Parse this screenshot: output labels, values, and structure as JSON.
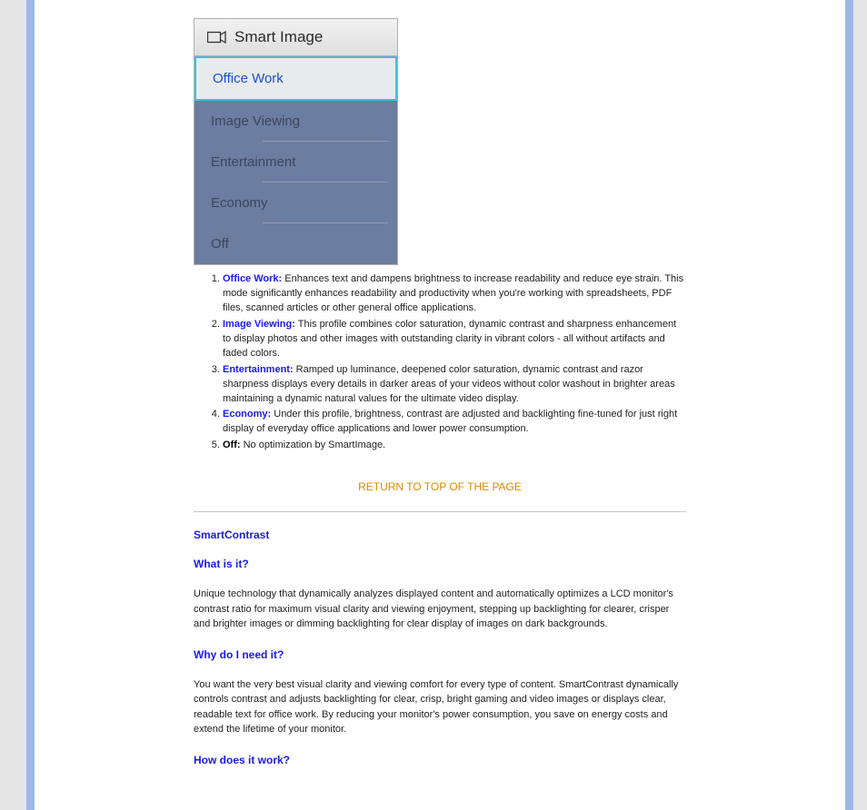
{
  "smartMenu": {
    "title": "Smart Image",
    "items": [
      "Office Work",
      "Image Viewing",
      "Entertainment",
      "Economy",
      "Off"
    ]
  },
  "modes": [
    {
      "term": "Office Work:",
      "desc": " Enhances text and dampens brightness to increase readability and reduce eye strain. This mode significantly enhances readability and productivity when you're working with spreadsheets, PDF files, scanned articles or other general office applications."
    },
    {
      "term": "Image Viewing:",
      "desc": " This profile combines color saturation, dynamic contrast and sharpness enhancement to display photos and other images with outstanding clarity in vibrant colors - all without artifacts and faded colors."
    },
    {
      "term": "Entertainment:",
      "desc": " Ramped up luminance, deepened color saturation, dynamic contrast and razor sharpness displays every details in darker areas of your videos without color washout in brighter areas maintaining a dynamic natural values for the ultimate video display."
    },
    {
      "term": "Economy:",
      "desc": " Under this profile, brightness, contrast are adjusted and backlighting fine-tuned for just right display of everyday office applications and lower power consumption."
    },
    {
      "term": "Off:",
      "desc": " No optimization by SmartImage."
    }
  ],
  "returnLink": "RETURN TO TOP OF THE PAGE",
  "smartContrast": {
    "title": "SmartContrast",
    "q1": "What is it?",
    "a1": "Unique technology that dynamically analyzes displayed content and automatically optimizes a LCD monitor's contrast ratio for maximum visual clarity and viewing enjoyment, stepping up backlighting for clearer, crisper and brighter images or dimming backlighting for clear display of images on dark backgrounds.",
    "q2": "Why do I need it?",
    "a2": "You want the very best visual clarity and viewing comfort for every type of content. SmartContrast dynamically controls contrast and adjusts backlighting for clear, crisp, bright gaming and video images or displays clear, readable text for office work. By reducing your monitor's power consumption, you save on energy costs and extend the lifetime of your monitor.",
    "q3": "How does it work?"
  }
}
